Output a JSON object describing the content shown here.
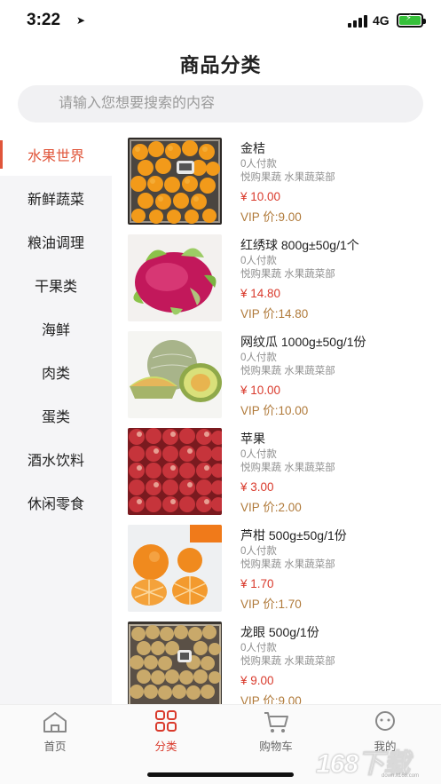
{
  "status_bar": {
    "time": "3:22",
    "network": "4G"
  },
  "page_title": "商品分类",
  "search": {
    "placeholder": "请输入您想要搜索的内容"
  },
  "sidebar": {
    "items": [
      {
        "label": "水果世界",
        "active": true
      },
      {
        "label": "新鲜蔬菜",
        "active": false
      },
      {
        "label": "粮油调理",
        "active": false
      },
      {
        "label": "干果类",
        "active": false
      },
      {
        "label": "海鲜",
        "active": false
      },
      {
        "label": "肉类",
        "active": false
      },
      {
        "label": "蛋类",
        "active": false
      },
      {
        "label": "酒水饮料",
        "active": false
      },
      {
        "label": "休闲零食",
        "active": false
      }
    ]
  },
  "products": [
    {
      "name": "金桔",
      "sold": "0人付款",
      "shop": "悦购果蔬 水果蔬菜部",
      "price": "¥ 10.00",
      "vip": "VIP 价:9.00",
      "image": "kumquat-image"
    },
    {
      "name": "红绣球 800g±50g/1个",
      "sold": "0人付款",
      "shop": "悦购果蔬 水果蔬菜部",
      "price": "¥ 14.80",
      "vip": "VIP 价:14.80",
      "image": "dragon-fruit-image"
    },
    {
      "name": "网纹瓜 1000g±50g/1份",
      "sold": "0人付款",
      "shop": "悦购果蔬 水果蔬菜部",
      "price": "¥ 10.00",
      "vip": "VIP 价:10.00",
      "image": "melon-image"
    },
    {
      "name": "苹果",
      "sold": "0人付款",
      "shop": "悦购果蔬 水果蔬菜部",
      "price": "¥ 3.00",
      "vip": "VIP 价:2.00",
      "image": "apple-image"
    },
    {
      "name": "芦柑 500g±50g/1份",
      "sold": "0人付款",
      "shop": "悦购果蔬 水果蔬菜部",
      "price": "¥ 1.70",
      "vip": "VIP 价:1.70",
      "image": "tangerine-image"
    },
    {
      "name": "龙眼 500g/1份",
      "sold": "0人付款",
      "shop": "悦购果蔬 水果蔬菜部",
      "price": "¥ 9.00",
      "vip": "VIP 价:9.00",
      "image": "longan-image"
    }
  ],
  "tabbar": {
    "items": [
      {
        "label": "首页",
        "icon": "home-icon",
        "active": false
      },
      {
        "label": "分类",
        "icon": "category-grid-icon",
        "active": true
      },
      {
        "label": "购物车",
        "icon": "cart-icon",
        "active": false
      },
      {
        "label": "我的",
        "icon": "profile-icon",
        "active": false
      }
    ]
  },
  "watermark": {
    "logo": "168下载",
    "small": "down.lt168.com"
  },
  "colors": {
    "accent": "#e0553a",
    "price": "#d93a2c",
    "vip": "#b07a3a",
    "sidebar_bg": "#f5f5f7"
  }
}
